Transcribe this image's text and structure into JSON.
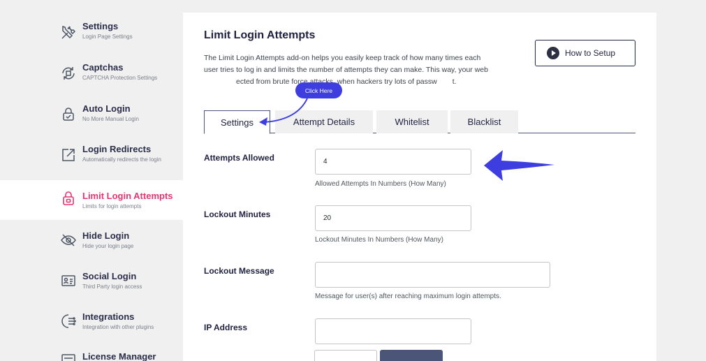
{
  "sidebar": {
    "items": [
      {
        "title": "Settings",
        "sub": "Login Page Settings",
        "icon": "tools-icon"
      },
      {
        "title": "Captchas",
        "sub": "CAPTCHA Protection Settings",
        "icon": "captcha-icon"
      },
      {
        "title": "Auto Login",
        "sub": "No More Manual Login",
        "icon": "auto-login-icon"
      },
      {
        "title": "Login Redirects",
        "sub": "Automatically redirects the login",
        "icon": "redirect-icon"
      },
      {
        "title": "Limit Login Attempts",
        "sub": "Limits for login attempts",
        "icon": "lock-icon"
      },
      {
        "title": "Hide Login",
        "sub": "Hide your login page",
        "icon": "eye-off-icon"
      },
      {
        "title": "Social Login",
        "sub": "Third Party login access",
        "icon": "social-card-icon"
      },
      {
        "title": "Integrations",
        "sub": "Integration with other plugins",
        "icon": "integrations-icon"
      },
      {
        "title": "License Manager",
        "sub": "",
        "icon": "license-icon"
      }
    ],
    "active_color": "#e3356e"
  },
  "main": {
    "title": "Limit Login Attempts",
    "description_before": "The Limit Login Attempts add-on helps you easily keep track of how many times each user tries to log in and limits the number of attempts they can make. This way, your web",
    "description_mid": "ected from brute force attacks, when hackers try lots of passw",
    "description_after": "t.",
    "setup_button": "How to Setup",
    "tabs": [
      "Settings",
      "Attempt Details",
      "Whitelist",
      "Blacklist"
    ],
    "fields": {
      "attempts": {
        "label": "Attempts Allowed",
        "value": "4",
        "hint": "Allowed Attempts In Numbers (How Many)"
      },
      "lockout_minutes": {
        "label": "Lockout Minutes",
        "value": "20",
        "hint": "Lockout Minutes In Numbers (How Many)"
      },
      "lockout_message": {
        "label": "Lockout Message",
        "value": "",
        "hint": "Message for user(s) after reaching maximum login attempts."
      },
      "ip_address": {
        "label": "IP Address",
        "value": ""
      }
    },
    "callout": "Click Here",
    "accent_color": "#3d3de0"
  }
}
